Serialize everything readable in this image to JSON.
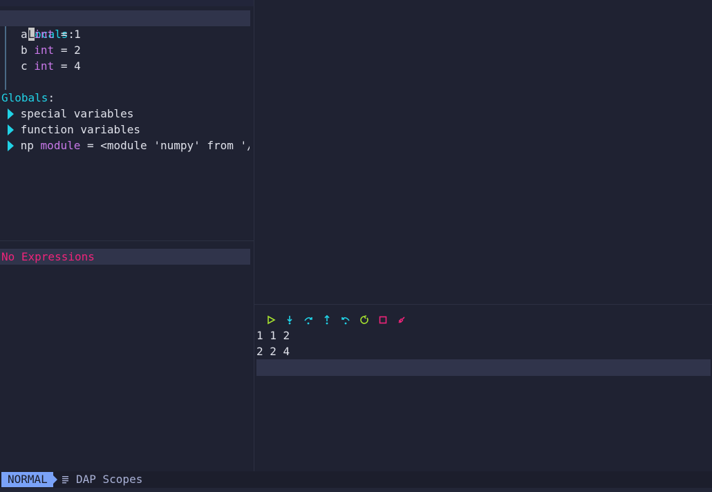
{
  "scopes": {
    "locals_label": "Locals",
    "locals_cursor_char": "L",
    "locals_label_rest": "ocals",
    "colon": ":",
    "locals": [
      {
        "name": "a",
        "type": "int",
        "value": "= 1"
      },
      {
        "name": "b",
        "type": "int",
        "value": "= 2"
      },
      {
        "name": "c",
        "type": "int",
        "value": "= 4"
      }
    ],
    "globals_label": "Globals",
    "globals": [
      {
        "name": "special variables",
        "type": "",
        "value": ""
      },
      {
        "name": "function variables",
        "type": "",
        "value": ""
      },
      {
        "name": "np",
        "type": "module",
        "value": "= <module 'numpy' from '/ho"
      }
    ]
  },
  "watches": {
    "empty_text": "No Expressions"
  },
  "controls": [
    {
      "icon": "play-icon",
      "color": "#a6e22e"
    },
    {
      "icon": "step-into-icon",
      "color": "#21d2e6"
    },
    {
      "icon": "step-over-icon",
      "color": "#21d2e6"
    },
    {
      "icon": "step-out-icon",
      "color": "#21d2e6"
    },
    {
      "icon": "step-back-icon",
      "color": "#21d2e6"
    },
    {
      "icon": "restart-icon",
      "color": "#a6e22e"
    },
    {
      "icon": "stop-icon",
      "color": "#f0247a"
    },
    {
      "icon": "disconnect-icon",
      "color": "#f0247a"
    }
  ],
  "repl": {
    "lines": [
      "1 1 2",
      "2 2 4"
    ]
  },
  "statusline": {
    "mode": "NORMAL",
    "buffer_icon": "lines-icon",
    "buffer_name": "DAP Scopes"
  },
  "colors": {
    "background": "#1f2232",
    "cursorline": "#30344b",
    "header": "#21d2e6",
    "type": "#c878e8",
    "error": "#f0247a",
    "mode_bg": "#7aa2f7"
  }
}
